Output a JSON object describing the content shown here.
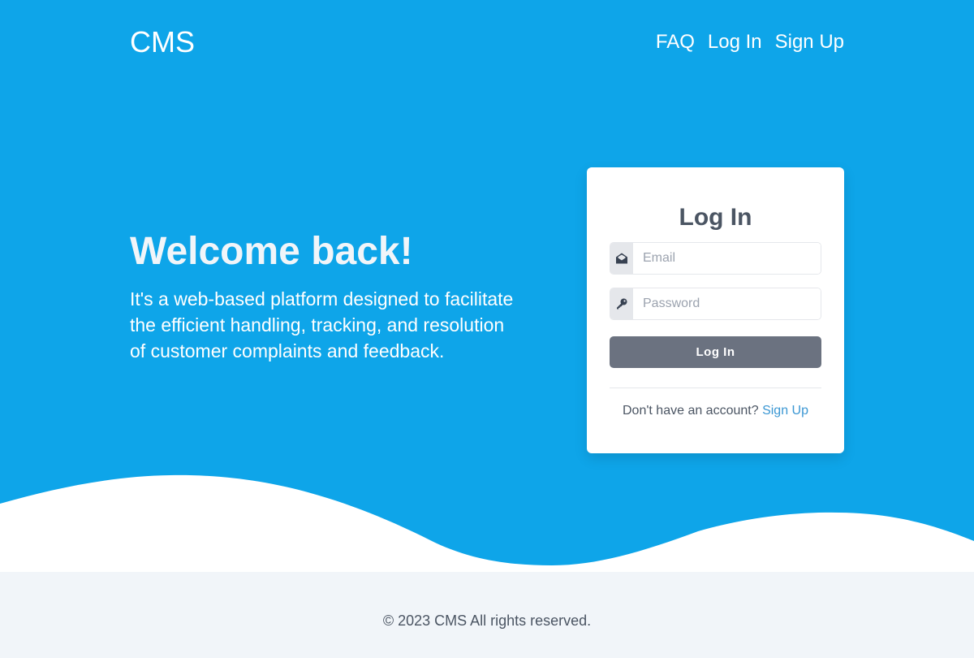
{
  "colors": {
    "hero_bg": "#0ea5e9",
    "footer_bg": "#f1f5f9",
    "button_bg": "#6b7280",
    "link": "#3b97d3",
    "heading_text": "#4b5563"
  },
  "nav": {
    "brand": "CMS",
    "links": [
      {
        "label": "FAQ"
      },
      {
        "label": "Log In"
      },
      {
        "label": "Sign Up"
      }
    ]
  },
  "hero": {
    "heading": "Welcome back!",
    "description": "It's a web-based platform designed to facilitate the efficient handling, tracking, and resolution of customer complaints and feedback."
  },
  "login_card": {
    "title": "Log In",
    "email": {
      "placeholder": "Email",
      "value": "",
      "icon": "envelope-open-icon"
    },
    "password": {
      "placeholder": "Password",
      "value": "",
      "icon": "key-icon"
    },
    "submit_label": "Log In",
    "signup_prompt": "Don't have an account?",
    "signup_link": "Sign Up"
  },
  "footer": {
    "copyright": "© 2023 CMS All rights reserved."
  }
}
